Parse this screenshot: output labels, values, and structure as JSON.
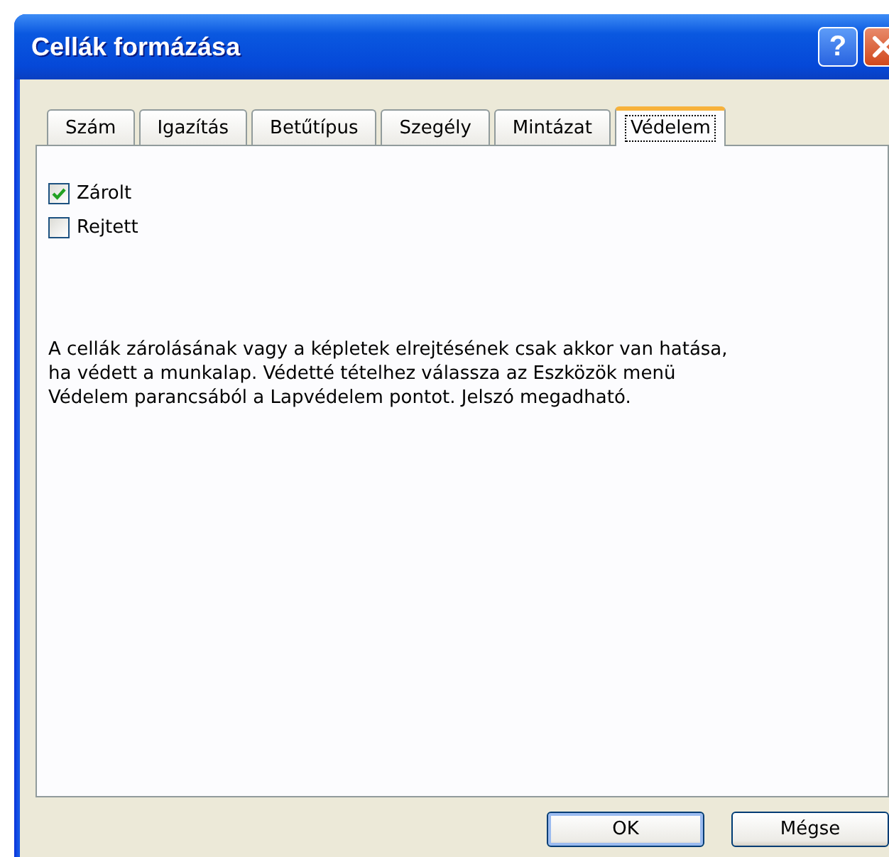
{
  "window": {
    "title": "Cellák formázása"
  },
  "title_buttons": [
    {
      "kind": "help",
      "label": "?"
    },
    {
      "kind": "close"
    }
  ],
  "tabs": [
    {
      "label": "Szám",
      "selected": false
    },
    {
      "label": "Igazítás",
      "selected": false
    },
    {
      "label": "Betűtípus",
      "selected": false
    },
    {
      "label": "Szegély",
      "selected": false
    },
    {
      "label": "Mintázat",
      "selected": false
    },
    {
      "label": "Védelem",
      "selected": true
    }
  ],
  "checkboxes": [
    {
      "label": "Zárolt",
      "checked": true
    },
    {
      "label": "Rejtett",
      "checked": false
    }
  ],
  "note": "A cellák zárolásának vagy a képletek elrejtésének csak akkor van hatása, ha védett a munkalap. Védetté tételhez válassza az Eszközök menü Védelem parancsából a Lapvédelem pontot. Jelszó megadható.",
  "buttons": [
    "OK",
    "Mégse"
  ]
}
